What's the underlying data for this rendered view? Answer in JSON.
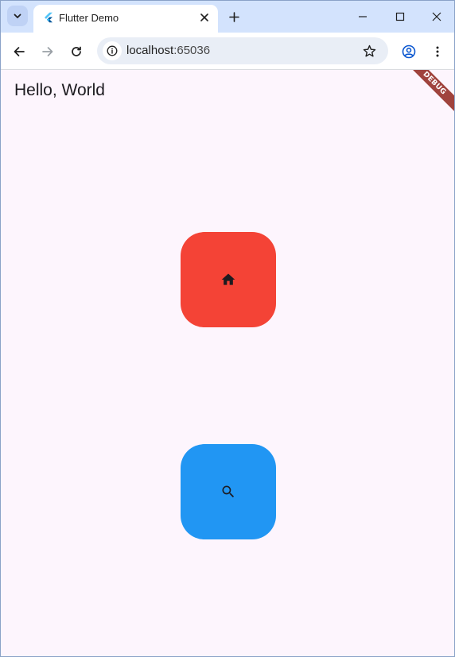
{
  "browser": {
    "tab": {
      "title": "Flutter Demo",
      "favicon": "flutter-logo-icon"
    },
    "address": {
      "host": "localhost",
      "port": ":65036"
    },
    "icons": {
      "tab_search": "chevron-down-icon",
      "close_tab": "close-icon",
      "new_tab": "plus-icon",
      "minimize": "minimize-icon",
      "maximize": "maximize-icon",
      "close_window": "close-icon",
      "back": "arrow-back-icon",
      "forward": "arrow-forward-icon",
      "reload": "reload-icon",
      "site_info": "info-icon",
      "bookmark": "star-icon",
      "profile": "account-icon",
      "menu": "more-vert-icon"
    }
  },
  "app": {
    "greeting": "Hello, World",
    "debug_banner": "DEBUG",
    "tiles": [
      {
        "icon": "home-icon",
        "color": "#f44336"
      },
      {
        "icon": "search-icon",
        "color": "#2196f3"
      }
    ],
    "background": "#fdf5fd"
  }
}
